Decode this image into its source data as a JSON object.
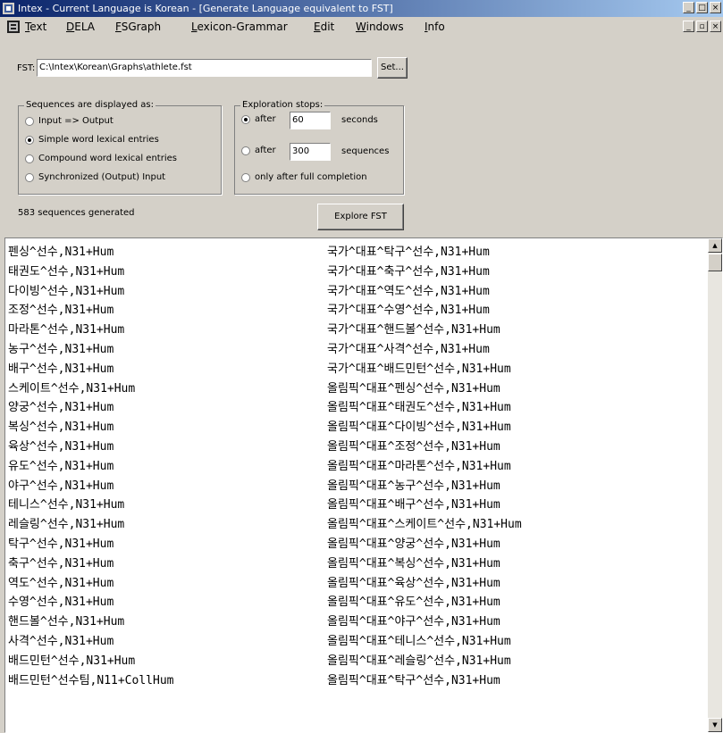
{
  "window": {
    "title": "Intex - Current Language is Korean - [Generate Language equivalent to FST]",
    "min_label": "_",
    "max_label": "□",
    "close_label": "×"
  },
  "menu": {
    "items": [
      {
        "prefix": "",
        "accel": "T",
        "rest": "ext"
      },
      {
        "prefix": "",
        "accel": "D",
        "rest": "ELA"
      },
      {
        "prefix": "",
        "accel": "F",
        "rest": "SGraph"
      },
      {
        "prefix": "",
        "accel": "L",
        "rest": "exicon-Grammar"
      },
      {
        "prefix": "",
        "accel": "E",
        "rest": "dit"
      },
      {
        "prefix": "",
        "accel": "W",
        "rest": "indows"
      },
      {
        "prefix": "",
        "accel": "I",
        "rest": "nfo"
      }
    ],
    "mdi_min_label": "_",
    "mdi_restore_label": "▫",
    "mdi_close_label": "×"
  },
  "fst": {
    "label": "FST:",
    "path": "C:\\Intex\\Korean\\Graphs\\athlete.fst",
    "set_button": "Set..."
  },
  "display_group": {
    "title": "Sequences are displayed as:",
    "options": [
      {
        "label": "Input => Output",
        "selected": false
      },
      {
        "label": "Simple word lexical entries",
        "selected": true
      },
      {
        "label": "Compound word lexical entries",
        "selected": false
      },
      {
        "label": "Synchronized (Output) Input",
        "selected": false
      }
    ]
  },
  "exploration_group": {
    "title": "Exploration stops:",
    "after_seconds_label": "after",
    "seconds_value": "60",
    "seconds_unit": "seconds",
    "after_sequences_label": "after",
    "sequences_value": "300",
    "sequences_unit": "sequences",
    "full_completion_label": "only after full completion",
    "selected": "seconds"
  },
  "status": {
    "generated": "583 sequences generated"
  },
  "explore_button": "Explore FST",
  "results": {
    "left": [
      "펜싱^선수,N31+Hum",
      "태권도^선수,N31+Hum",
      "다이빙^선수,N31+Hum",
      "조정^선수,N31+Hum",
      "마라톤^선수,N31+Hum",
      "농구^선수,N31+Hum",
      "배구^선수,N31+Hum",
      "스케이트^선수,N31+Hum",
      "양궁^선수,N31+Hum",
      "복싱^선수,N31+Hum",
      "육상^선수,N31+Hum",
      "유도^선수,N31+Hum",
      "야구^선수,N31+Hum",
      "테니스^선수,N31+Hum",
      "레슬링^선수,N31+Hum",
      "탁구^선수,N31+Hum",
      "축구^선수,N31+Hum",
      "역도^선수,N31+Hum",
      "수영^선수,N31+Hum",
      "핸드볼^선수,N31+Hum",
      "사격^선수,N31+Hum",
      "배드민턴^선수,N31+Hum",
      "배드민턴^선수팀,N11+CollHum"
    ],
    "right": [
      "국가^대표^탁구^선수,N31+Hum",
      "국가^대표^축구^선수,N31+Hum",
      "국가^대표^역도^선수,N31+Hum",
      "국가^대표^수영^선수,N31+Hum",
      "국가^대표^핸드볼^선수,N31+Hum",
      "국가^대표^사격^선수,N31+Hum",
      "국가^대표^배드민턴^선수,N31+Hum",
      "올림픽^대표^펜싱^선수,N31+Hum",
      "올림픽^대표^태권도^선수,N31+Hum",
      "올림픽^대표^다이빙^선수,N31+Hum",
      "올림픽^대표^조정^선수,N31+Hum",
      "올림픽^대표^마라톤^선수,N31+Hum",
      "올림픽^대표^농구^선수,N31+Hum",
      "올림픽^대표^배구^선수,N31+Hum",
      "올림픽^대표^스케이트^선수,N31+Hum",
      "올림픽^대표^양궁^선수,N31+Hum",
      "올림픽^대표^복싱^선수,N31+Hum",
      "올림픽^대표^육상^선수,N31+Hum",
      "올림픽^대표^유도^선수,N31+Hum",
      "올림픽^대표^야구^선수,N31+Hum",
      "올림픽^대표^테니스^선수,N31+Hum",
      "올림픽^대표^레슬링^선수,N31+Hum",
      "올림픽^대표^탁구^선수,N31+Hum"
    ]
  },
  "scroll": {
    "up_arrow": "▲",
    "down_arrow": "▼"
  }
}
